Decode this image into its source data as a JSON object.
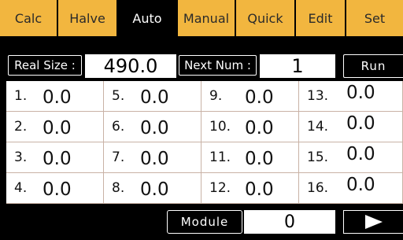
{
  "tabs": [
    {
      "label": "Calc"
    },
    {
      "label": "Halve"
    },
    {
      "label": "Auto"
    },
    {
      "label": "Manual"
    },
    {
      "label": "Quick"
    },
    {
      "label": "Edit"
    },
    {
      "label": "Set"
    }
  ],
  "active_tab": "Auto",
  "header": {
    "real_size_label": "Real Size :",
    "real_size_value": "490.0",
    "next_num_label": "Next Num :",
    "next_num_value": "1",
    "run_label": "Run"
  },
  "grid": {
    "cells": [
      {
        "index": "1.",
        "value": "0.0"
      },
      {
        "index": "5.",
        "value": "0.0"
      },
      {
        "index": "9.",
        "value": "0.0"
      },
      {
        "index": "13.",
        "value": "0.0"
      },
      {
        "index": "2.",
        "value": "0.0"
      },
      {
        "index": "6.",
        "value": "0.0"
      },
      {
        "index": "10.",
        "value": "0.0"
      },
      {
        "index": "14.",
        "value": "0.0"
      },
      {
        "index": "3.",
        "value": "0.0"
      },
      {
        "index": "7.",
        "value": "0.0"
      },
      {
        "index": "11.",
        "value": "0.0"
      },
      {
        "index": "15.",
        "value": "0.0"
      },
      {
        "index": "4.",
        "value": "0.0"
      },
      {
        "index": "8.",
        "value": "0.0"
      },
      {
        "index": "12.",
        "value": "0.0"
      },
      {
        "index": "16.",
        "value": "0.0"
      }
    ]
  },
  "footer": {
    "module_label": "Module",
    "module_value": "0",
    "next_icon": "play-icon"
  },
  "colors": {
    "tab_bg": "#f2b63f",
    "background": "#000000",
    "grid_line": "#c9b2a6"
  }
}
